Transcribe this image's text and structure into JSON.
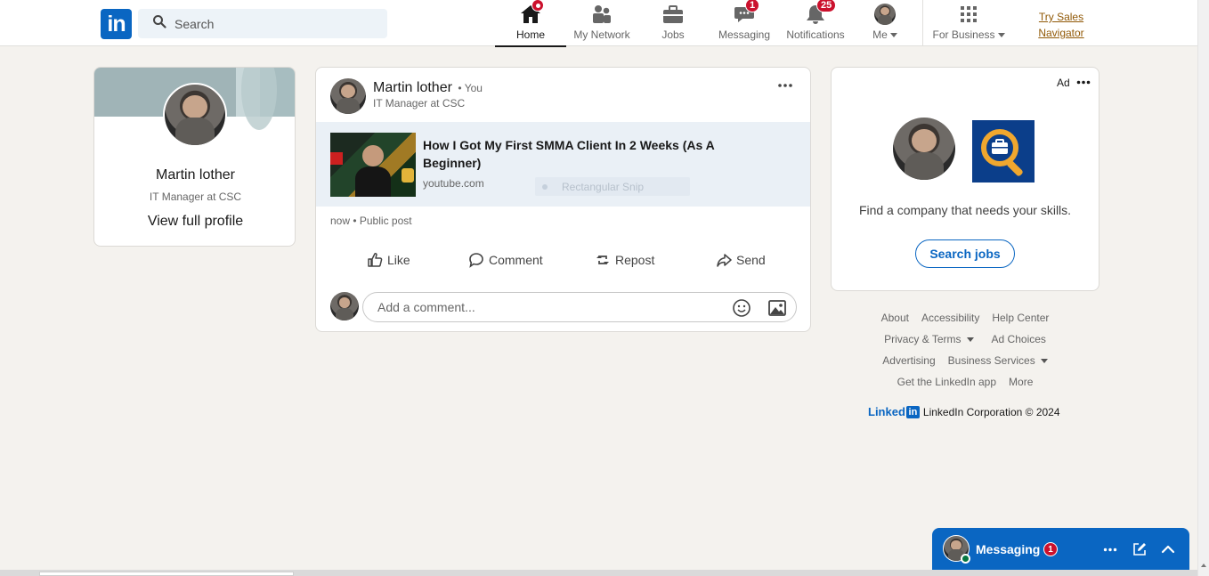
{
  "nav": {
    "search_placeholder": "Search",
    "items": [
      {
        "label": "Home",
        "icon": "home-icon"
      },
      {
        "label": "My Network",
        "icon": "network-icon"
      },
      {
        "label": "Jobs",
        "icon": "briefcase-icon"
      },
      {
        "label": "Messaging",
        "icon": "messaging-icon",
        "badge": "1"
      },
      {
        "label": "Notifications",
        "icon": "bell-icon",
        "badge": "25"
      },
      {
        "label": "Me",
        "icon": "avatar"
      },
      {
        "label": "For Business",
        "icon": "grid-icon"
      }
    ],
    "try_sales": [
      "Try Sales",
      "Navigator"
    ]
  },
  "profile": {
    "name": "Martin lother",
    "headline": "IT Manager at CSC",
    "link": "View full profile"
  },
  "post": {
    "author": "Martin lother",
    "you": "• You",
    "headline": "IT Manager at CSC",
    "preview_title": "How I Got My First SMMA Client In 2 Weeks (As A Beginner)",
    "preview_domain": "youtube.com",
    "snip_overlay": "Rectangular Snip",
    "meta": "now • Public post",
    "actions": [
      "Like",
      "Comment",
      "Repost",
      "Send"
    ],
    "comment_placeholder": "Add a comment..."
  },
  "ad": {
    "label": "Ad",
    "text": "Find a company that needs your skills.",
    "button": "Search jobs"
  },
  "footer": {
    "row1": [
      "About",
      "Accessibility",
      "Help Center"
    ],
    "row2": [
      "Privacy & Terms",
      "Ad Choices"
    ],
    "row3": [
      "Advertising",
      "Business Services"
    ],
    "row4": [
      "Get the LinkedIn app",
      "More"
    ],
    "brand_word": "Linked",
    "brand_box": "in",
    "copyright": "LinkedIn Corporation © 2024"
  },
  "messaging_dock": {
    "title": "Messaging",
    "badge": "1"
  },
  "colors": {
    "brand": "#0a66c2",
    "badge": "#cb112d",
    "background": "#f4f2ee",
    "sales_link": "#915907"
  }
}
